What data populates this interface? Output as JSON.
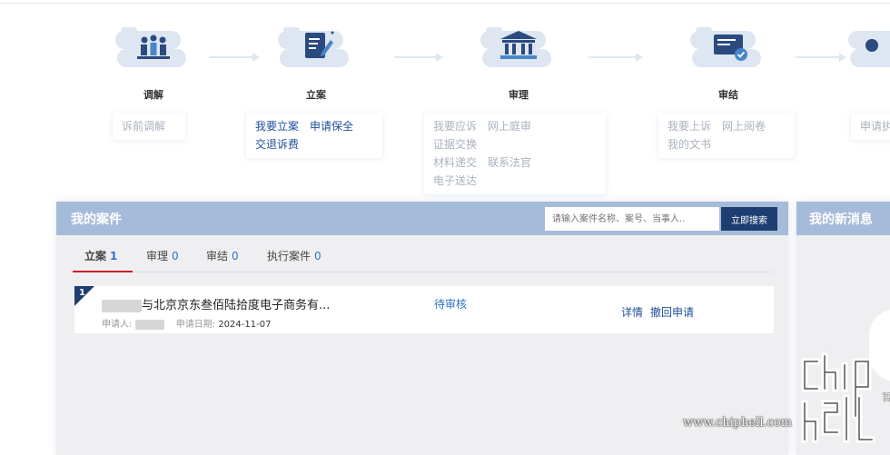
{
  "steps": [
    {
      "label": "调解"
    },
    {
      "label": "立案"
    },
    {
      "label": "审理"
    },
    {
      "label": "审结"
    }
  ],
  "step_links": {
    "mediation": [
      "诉前调解"
    ],
    "filing": [
      "我要立案",
      "申请保全",
      "交退诉费"
    ],
    "trial": [
      "我要应诉",
      "网上庭审",
      "证据交换",
      "材料递交",
      "联系法官",
      "电子送达"
    ],
    "closed": [
      "我要上诉",
      "网上阅卷",
      "我的文书"
    ],
    "partial": "申请执"
  },
  "cases": {
    "title": "我的案件",
    "search_placeholder": "请输入案件名称、案号、当事人..",
    "search_button": "立即搜索",
    "tabs": [
      {
        "label": "立案",
        "count": "1"
      },
      {
        "label": "审理",
        "count": "0"
      },
      {
        "label": "审结",
        "count": "0"
      },
      {
        "label": "执行案件",
        "count": "0"
      }
    ],
    "rows": [
      {
        "index": "1",
        "title": "与北京京东叁佰陆拾度电子商务有...",
        "applicant_label": "申请人:",
        "date_label": "申请日期:",
        "date": "2024-11-07",
        "status": "待审核",
        "action_detail": "详情",
        "action_withdraw": "撤回申请"
      }
    ]
  },
  "messages": {
    "title": "我的新消息",
    "partial_text": "暂"
  },
  "watermark": {
    "url": "www.chiphell.com"
  },
  "colors": {
    "panel_header": "#a6bbd9",
    "navy": "#1e3e73",
    "link_blue": "#1f4e9c",
    "accent_red": "#c81e2b"
  }
}
